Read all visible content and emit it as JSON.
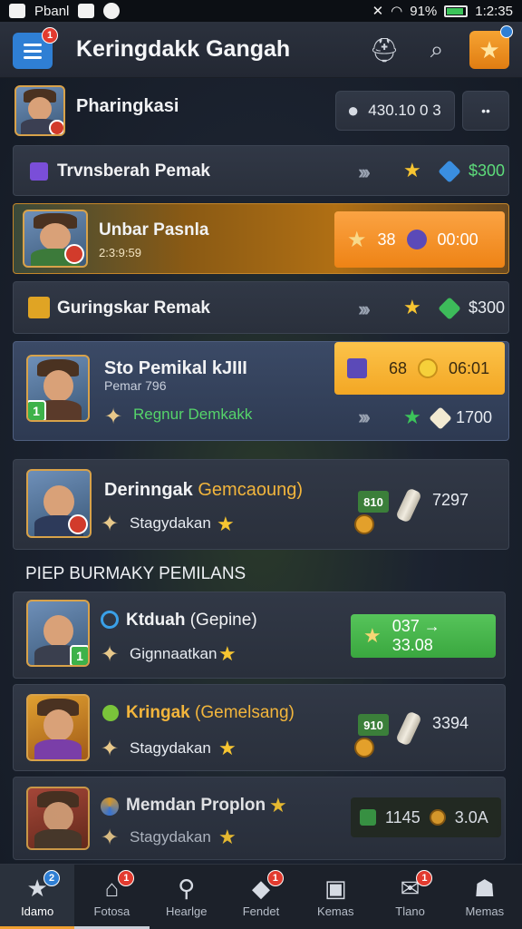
{
  "status_bar": {
    "carrier": "Pbanl",
    "battery": "91%",
    "time": "1:2:35"
  },
  "header": {
    "title": "Keringdakk Gangah",
    "menu_badge": "1"
  },
  "profile": {
    "name": "Pharingkasi",
    "coins": "430.10 0 3",
    "more": "••"
  },
  "rows": [
    {
      "label": "Trvnsberah Pemak",
      "price": "$300"
    },
    {
      "name": "Unbar Pasnla",
      "sub": "2:3:9:59",
      "pill_num": "38",
      "pill_time": "00:00"
    },
    {
      "label": "Guringskar Remak",
      "price": "$300"
    },
    {
      "name": "Sto Pemikal kJIII",
      "sub": "Pemar 796",
      "pill_num": "68",
      "pill_time": "06:01",
      "extra": "Regnur Demkakk",
      "price": "1700"
    }
  ],
  "featured": {
    "name": "Derinngak",
    "name_hl": "Gemcaoung)",
    "sub": "Stagydakan",
    "badge": "810",
    "count": "7297"
  },
  "section_title": "PIEP BURMAKY PEMILANS",
  "list": [
    {
      "name": "Ktduah",
      "name_hl": "(Gepine)",
      "sub": "Gignnaatkan",
      "btn": "037 → 33.08",
      "lvl": "1"
    },
    {
      "name": "Kringak",
      "name_hl": "(Gemelsang)",
      "sub": "Stagydakan",
      "badge": "910",
      "count": "3394"
    },
    {
      "name": "Memdan Proplon",
      "sub": "Stagydakan",
      "badge": "1145",
      "count": "3.0A"
    }
  ],
  "nav": [
    {
      "label": "Idamo",
      "icon": "star-icon",
      "badge": "2"
    },
    {
      "label": "Fotosa",
      "icon": "home-icon",
      "badge": "1"
    },
    {
      "label": "Hearlge",
      "icon": "user-icon"
    },
    {
      "label": "Fendet",
      "icon": "gem-icon",
      "badge": "1"
    },
    {
      "label": "Kemas",
      "icon": "map-icon"
    },
    {
      "label": "Tlano",
      "icon": "mail-icon",
      "badge": "1"
    },
    {
      "label": "Memas",
      "icon": "profile-icon"
    }
  ],
  "colors": {
    "accent_orange": "#ee8315",
    "accent_yellow": "#f3a724",
    "accent_green": "#3aa73f",
    "menu_blue": "#2f7fd4"
  }
}
